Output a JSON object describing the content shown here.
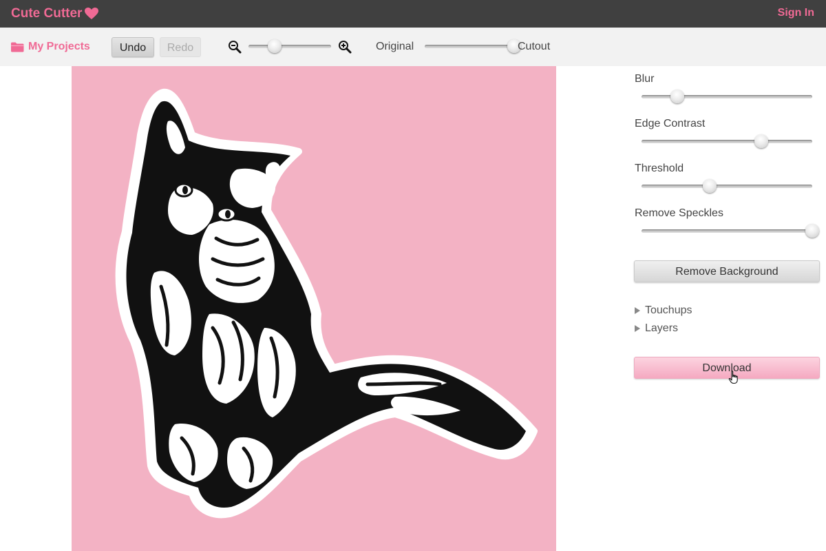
{
  "header": {
    "brand_name": "Cute Cutter",
    "brand_icon": "heart-icon",
    "sign_in_label": "Sign In",
    "accent_color": "#f06a95",
    "bar_color": "#404040"
  },
  "toolbar": {
    "projects_label": "My Projects",
    "projects_icon": "folder-icon",
    "undo_label": "Undo",
    "redo_label": "Redo",
    "redo_enabled": false,
    "zoom_out_icon": "zoom-out-icon",
    "zoom_in_icon": "zoom-in-icon",
    "zoom_level": 0.32,
    "view_original_label": "Original",
    "view_cutout_label": "Cutout",
    "view_mix": 1.0
  },
  "canvas": {
    "background_color": "#f3b2c4",
    "content": "cat-cutout"
  },
  "panel": {
    "sliders": [
      {
        "label": "Blur",
        "value": 0.21
      },
      {
        "label": "Edge Contrast",
        "value": 0.7
      },
      {
        "label": "Threshold",
        "value": 0.4
      },
      {
        "label": "Remove Speckles",
        "value": 1.0
      }
    ],
    "remove_background_label": "Remove Background",
    "sections": [
      {
        "label": "Touchups",
        "expanded": false
      },
      {
        "label": "Layers",
        "expanded": false
      }
    ],
    "download_label": "Download"
  }
}
